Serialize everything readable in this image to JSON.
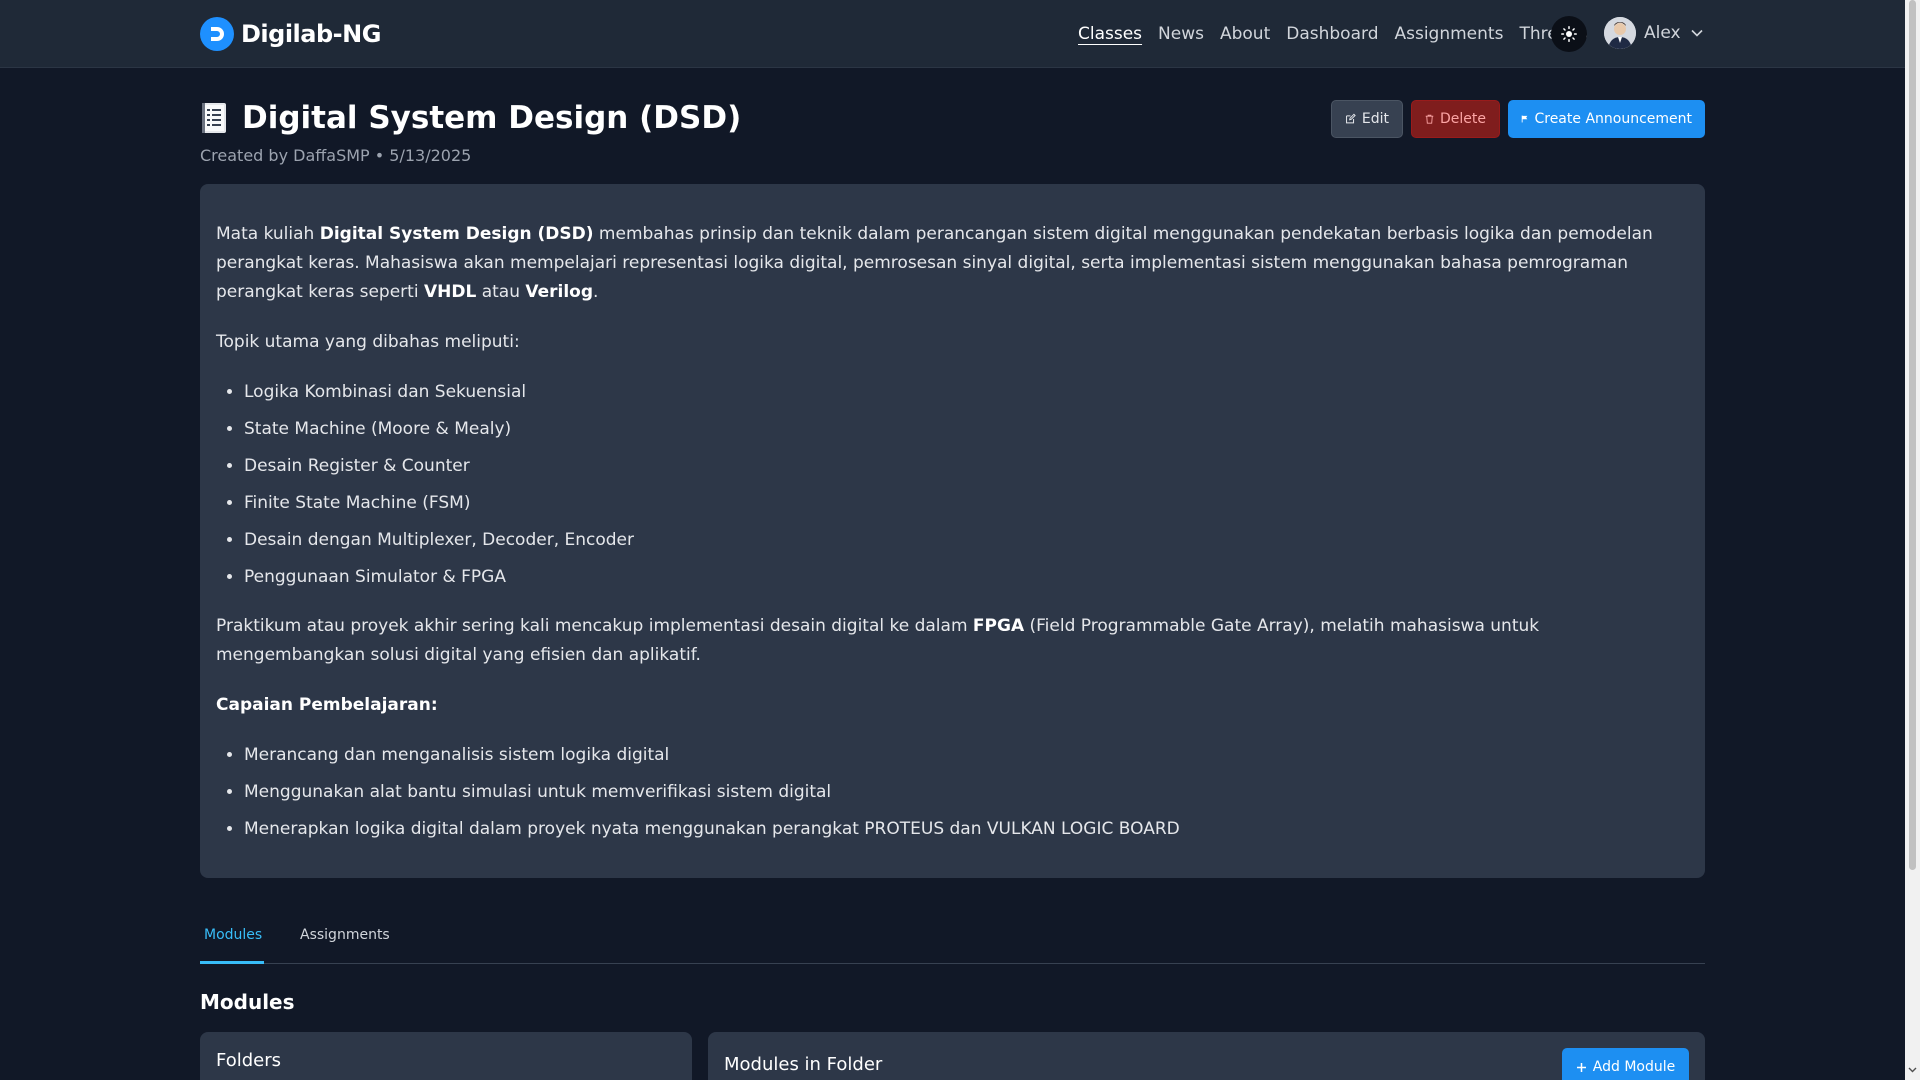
{
  "nav": {
    "brand": "Digilab-NG",
    "links": [
      "Classes",
      "News",
      "About",
      "Dashboard",
      "Assignments",
      "Threads"
    ],
    "active_link": "Classes",
    "user_name": "Alex"
  },
  "header": {
    "title": "Digital System Design (DSD)",
    "meta": "Created by DaffaSMP • 5/13/2025",
    "edit_label": "Edit",
    "delete_label": "Delete",
    "create_label": "Create Announcement"
  },
  "description": {
    "intro_prefix": "Mata kuliah ",
    "intro_bold": "Digital System Design (DSD)",
    "intro_mid": " membahas prinsip dan teknik dalam perancangan sistem digital menggunakan pendekatan berbasis logika dan pemodelan perangkat keras. Mahasiswa akan mempelajari representasi logika digital, pemrosesan sinyal digital, serta implementasi sistem menggunakan bahasa pemrograman perangkat keras seperti ",
    "intro_vhdl": "VHDL",
    "intro_atau": " atau ",
    "intro_verilog": "Verilog",
    "intro_end": ".",
    "topics_heading": "Topik utama yang dibahas meliputi:",
    "topics": [
      "Logika Kombinasi dan Sekuensial",
      "State Machine (Moore & Mealy)",
      "Desain Register & Counter",
      "Finite State Machine (FSM)",
      "Desain dengan Multiplexer, Decoder, Encoder",
      "Penggunaan Simulator & FPGA"
    ],
    "praktikum_prefix": "Praktikum atau proyek akhir sering kali mencakup implementasi desain digital ke dalam ",
    "praktikum_bold": "FPGA",
    "praktikum_suffix": " (Field Programmable Gate Array), melatih mahasiswa untuk mengembangkan solusi digital yang efisien dan aplikatif.",
    "outcomes_heading": "Capaian Pembelajaran:",
    "outcomes": [
      "Merancang dan menganalisis sistem logika digital",
      "Menggunakan alat bantu simulasi untuk memverifikasi sistem digital",
      "Menerapkan logika digital dalam proyek nyata menggunakan perangkat PROTEUS dan VULKAN LOGIC BOARD"
    ]
  },
  "tabs": {
    "modules": "Modules",
    "assignments": "Assignments",
    "active": "Modules"
  },
  "modules_section": {
    "title": "Modules",
    "folders_title": "Folders",
    "modules_in_folder_title": "Modules in Folder",
    "add_module_label": "Add Module"
  },
  "colors": {
    "background": "#111827",
    "navbar": "#1f2937",
    "card": "#2d3748",
    "primary": "#1d8ff2",
    "accent_tab": "#38bdf8",
    "danger": "#7f1d1d"
  },
  "icons": {
    "brand": "logo-icon",
    "theme": "sun-icon",
    "user_chevron": "chevron-down-icon",
    "class": "document-icon",
    "edit": "edit-icon",
    "delete": "trash-icon",
    "announcement": "flag-icon",
    "add": "plus-icon"
  }
}
